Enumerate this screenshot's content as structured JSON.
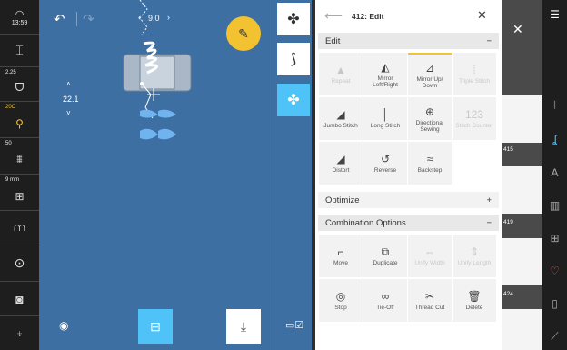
{
  "status": {
    "time": "13:59"
  },
  "left_bar": {
    "speed_value": "2.25",
    "temp_value": "20C",
    "tension_value": "50",
    "height_value": "9 mm"
  },
  "canvas": {
    "width_value": "9.0",
    "position_value": "22.1"
  },
  "edit_panel": {
    "title": "412: Edit",
    "sections": {
      "edit": {
        "label": "Edit",
        "toggle": "−"
      },
      "optimize": {
        "label": "Optimize",
        "toggle": "+"
      },
      "combination": {
        "label": "Combination Options",
        "toggle": "−"
      }
    },
    "edit_tools": [
      {
        "label": "Repeat",
        "icon": "▲",
        "disabled": true
      },
      {
        "label": "Mirror Left/Right",
        "icon": "◭",
        "disabled": false
      },
      {
        "label": "Mirror Up/ Down",
        "icon": "⊿",
        "disabled": false,
        "selected": true
      },
      {
        "label": "Triple Stitch",
        "icon": "⦙",
        "disabled": true
      },
      {
        "label": "Jumbo Stitch",
        "icon": "◢",
        "disabled": false
      },
      {
        "label": "Long Stitch",
        "icon": "│",
        "disabled": false
      },
      {
        "label": "Directional Sewing",
        "icon": "⊕",
        "disabled": false
      },
      {
        "label": "Stitch Counter",
        "icon": "123",
        "disabled": true
      },
      {
        "label": "Distort",
        "icon": "◢",
        "disabled": false
      },
      {
        "label": "Reverse",
        "icon": "↺",
        "disabled": false
      },
      {
        "label": "Backstep",
        "icon": "≈",
        "disabled": false
      }
    ],
    "combination_tools": [
      {
        "label": "Move",
        "icon": "⌐",
        "disabled": false
      },
      {
        "label": "Duplicate",
        "icon": "⧉",
        "disabled": false
      },
      {
        "label": "Unify Width",
        "icon": "⇔",
        "disabled": true
      },
      {
        "label": "Unify Length",
        "icon": "⇕",
        "disabled": true
      },
      {
        "label": "Stop",
        "icon": "◎",
        "disabled": false
      },
      {
        "label": "Tie-Off",
        "icon": "∞",
        "disabled": false
      },
      {
        "label": "Thread Cut",
        "icon": "✂",
        "disabled": false
      },
      {
        "label": "Delete",
        "icon": "🗑",
        "disabled": false
      }
    ]
  },
  "stitch_list": {
    "numbers": [
      "415",
      "419",
      "424"
    ]
  },
  "colors": {
    "canvas_blue": "#3d6fa3",
    "accent_yellow": "#f2c230",
    "selected_cyan": "#4fc3f7"
  }
}
